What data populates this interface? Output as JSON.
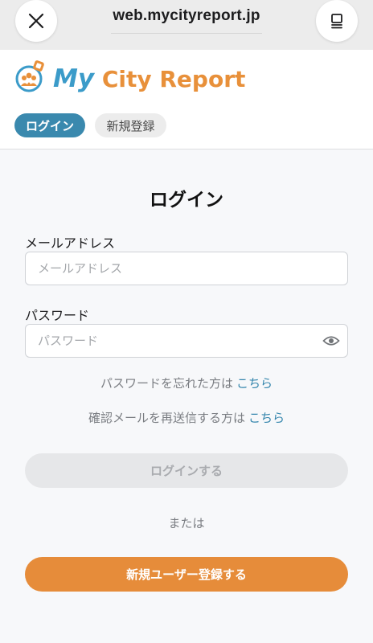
{
  "browser": {
    "url": "web.mycityreport.jp",
    "close_icon": "close-icon",
    "tabs_icon": "tabs-icon"
  },
  "header": {
    "logo": {
      "my": "My",
      "city": "City",
      "report": "Report",
      "colors": {
        "my": "#3b9bc9",
        "city_report": "#e8903a"
      }
    },
    "tabs": [
      {
        "label": "ログイン",
        "active": true
      },
      {
        "label": "新規登録",
        "active": false
      }
    ]
  },
  "form": {
    "title": "ログイン",
    "email": {
      "label": "メールアドレス",
      "placeholder": "メールアドレス",
      "value": ""
    },
    "password": {
      "label": "パスワード",
      "placeholder": "パスワード",
      "value": "",
      "toggle_icon": "eye-icon"
    },
    "forgot_password": {
      "text": "パスワードを忘れた方は",
      "link": "こちら"
    },
    "resend_confirmation": {
      "text": "確認メールを再送信する方は",
      "link": "こちら"
    },
    "login_button": "ログインする",
    "or_text": "または",
    "register_button": "新規ユーザー登録する"
  },
  "colors": {
    "primary_blue": "#3a89ae",
    "link_blue": "#3586ad",
    "accent_orange": "#e68c3a",
    "disabled_gray": "#e6e7e9"
  }
}
